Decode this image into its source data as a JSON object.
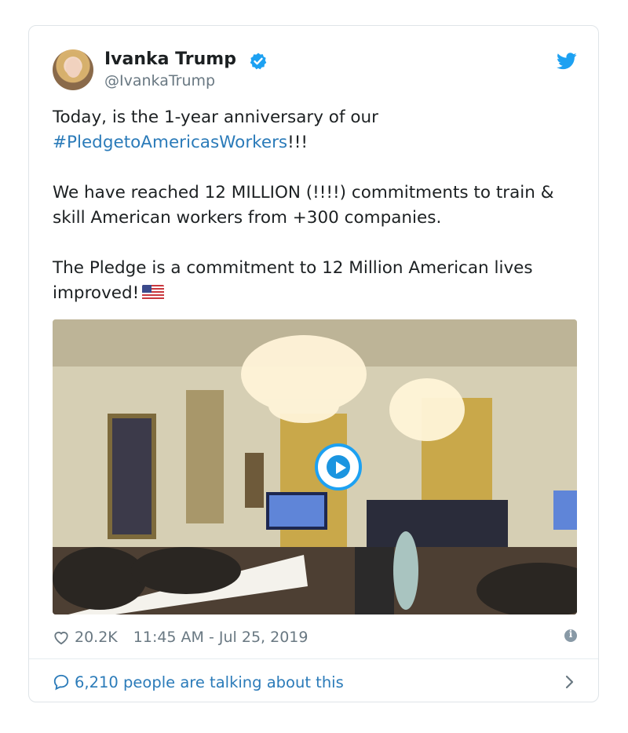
{
  "tweet": {
    "author_name": "Ivanka Trump",
    "handle": "@IvankaTrump",
    "text": {
      "line1": "Today, is the 1-year anniversary of our",
      "hashtag": "#PledgetoAmericasWorkers",
      "after_hashtag": "!!!",
      "para2": "We have reached 12 MILLION (!!!!) commitments to train & skill American workers from +300 companies.",
      "para3": "The Pledge is a commitment to 12 Million American lives improved!"
    },
    "likes": "20.2K",
    "timestamp": "11:45 AM - Jul 25, 2019",
    "talking": "6,210 people are talking about this"
  },
  "icons": {
    "verified": "verified-badge-icon",
    "brand": "twitter-bird-icon",
    "flag": "us-flag-emoji",
    "like": "heart-icon",
    "info": "info-icon",
    "reply": "speech-bubble-icon",
    "chevron": "chevron-right-icon",
    "play": "play-icon"
  },
  "colors": {
    "accent": "#1da1f2",
    "link": "#2b7bb9",
    "text": "#1c2022",
    "muted": "#697882"
  }
}
